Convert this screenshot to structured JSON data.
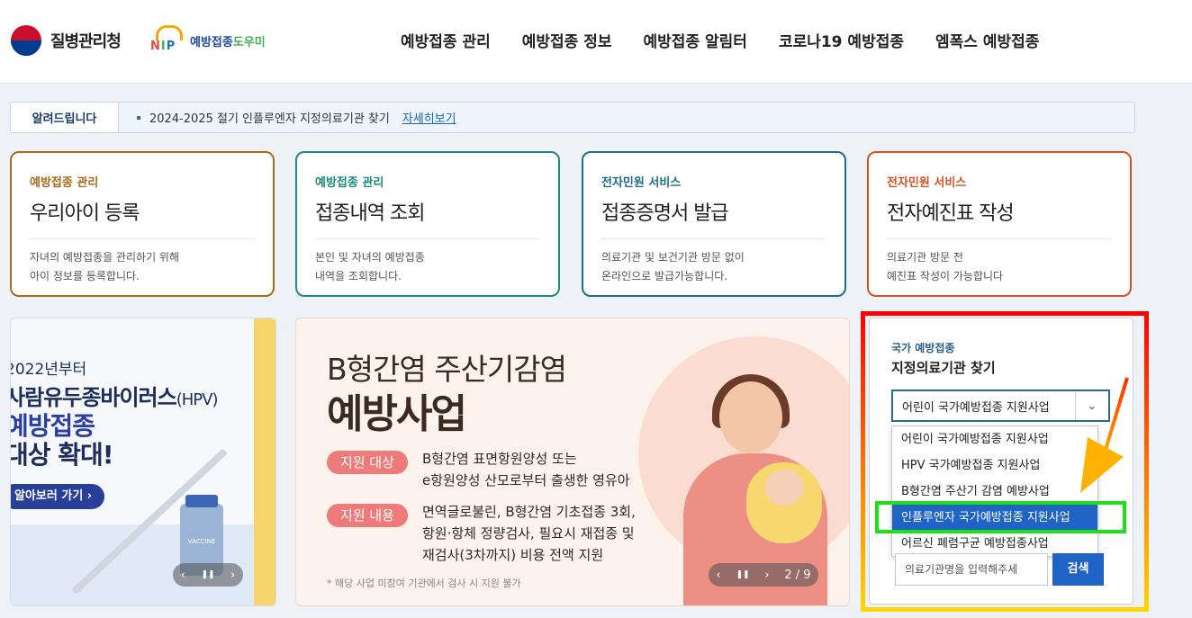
{
  "header": {
    "brand": "질병관리청",
    "nip_letters": [
      "N",
      "I",
      "P"
    ],
    "nip_name": "예방접종",
    "nip_name_green": "도우미",
    "nav": [
      "예방접종 관리",
      "예방접종 정보",
      "예방접종 알림터",
      "코로나19 예방접종",
      "엠폭스 예방접종"
    ]
  },
  "notice": {
    "label": "알려드립니다",
    "text": "2024-2025 절기 인플루엔자 지정의료기관 찾기",
    "link": "자세히보기"
  },
  "cards": [
    {
      "category": "예방접종 관리",
      "title": "우리아이 등록",
      "desc": [
        "자녀의 예방접종을 관리하기 위해",
        "아이 정보를 등록합니다."
      ],
      "color": "#a86a1b"
    },
    {
      "category": "예방접종 관리",
      "title": "접종내역 조회",
      "desc": [
        "본인 및 자녀의 예방접종",
        "내역을 조회합니다."
      ],
      "color": "#1e8a7a"
    },
    {
      "category": "전자민원 서비스",
      "title": "접종증명서 발급",
      "desc": [
        "의료기관 및 보건기관 방문 없이",
        "온라인으로 발급가능합니다."
      ],
      "color": "#1f6e8a"
    },
    {
      "category": "전자민원 서비스",
      "title": "전자예진표 작성",
      "desc": [
        "의료기관 방문 전",
        "예진표 작성이 가능합니다"
      ],
      "color": "#d35420"
    }
  ],
  "banner_hpv": {
    "line1": "2022년부터",
    "line2": "사람유두종바이러스",
    "line2_small": "(HPV)",
    "line3": "예방접종",
    "line4": "대상 확대!",
    "button": "알아보러 가기  ›",
    "vial_label": "VACCINE",
    "ctrl": [
      "‹",
      "❚❚",
      "›"
    ]
  },
  "banner_hepb": {
    "title1": "B형간염 주산기감염",
    "title2": "예방사업",
    "tag1": "지원 대상",
    "text1": [
      "B형간염 표면항원양성 또는",
      "e항원양성 산모로부터 출생한 영유아"
    ],
    "tag2": "지원 내용",
    "text2": [
      "면역글로불린, B형간염 기초접종 3회,",
      "항원·항체 정량검사, 필요시 재접종 및",
      "재검사(3차까지) 비용 전액 지원"
    ],
    "footnote": "* 해당 사업 미참여 기관에서 검사 시 지원 불가",
    "ctrl": [
      "‹",
      "❚❚",
      "›",
      "2 / 9"
    ]
  },
  "finder": {
    "subtitle": "국가 예방접종",
    "title": "지정의료기관 찾기",
    "selected": "어린이 국가예방접종 지원사업",
    "options": [
      "어린이 국가예방접종 지원사업",
      "HPV 국가예방접종 지원사업",
      "B형간염 주산기 감염 예방사업",
      "인플루엔자 국가예방접종 지원사업",
      "어르신 폐렴구균 예방접종사업"
    ],
    "highlighted_index": 3,
    "search_placeholder": "의료기관명을 입력해주세",
    "search_button": "검색"
  }
}
